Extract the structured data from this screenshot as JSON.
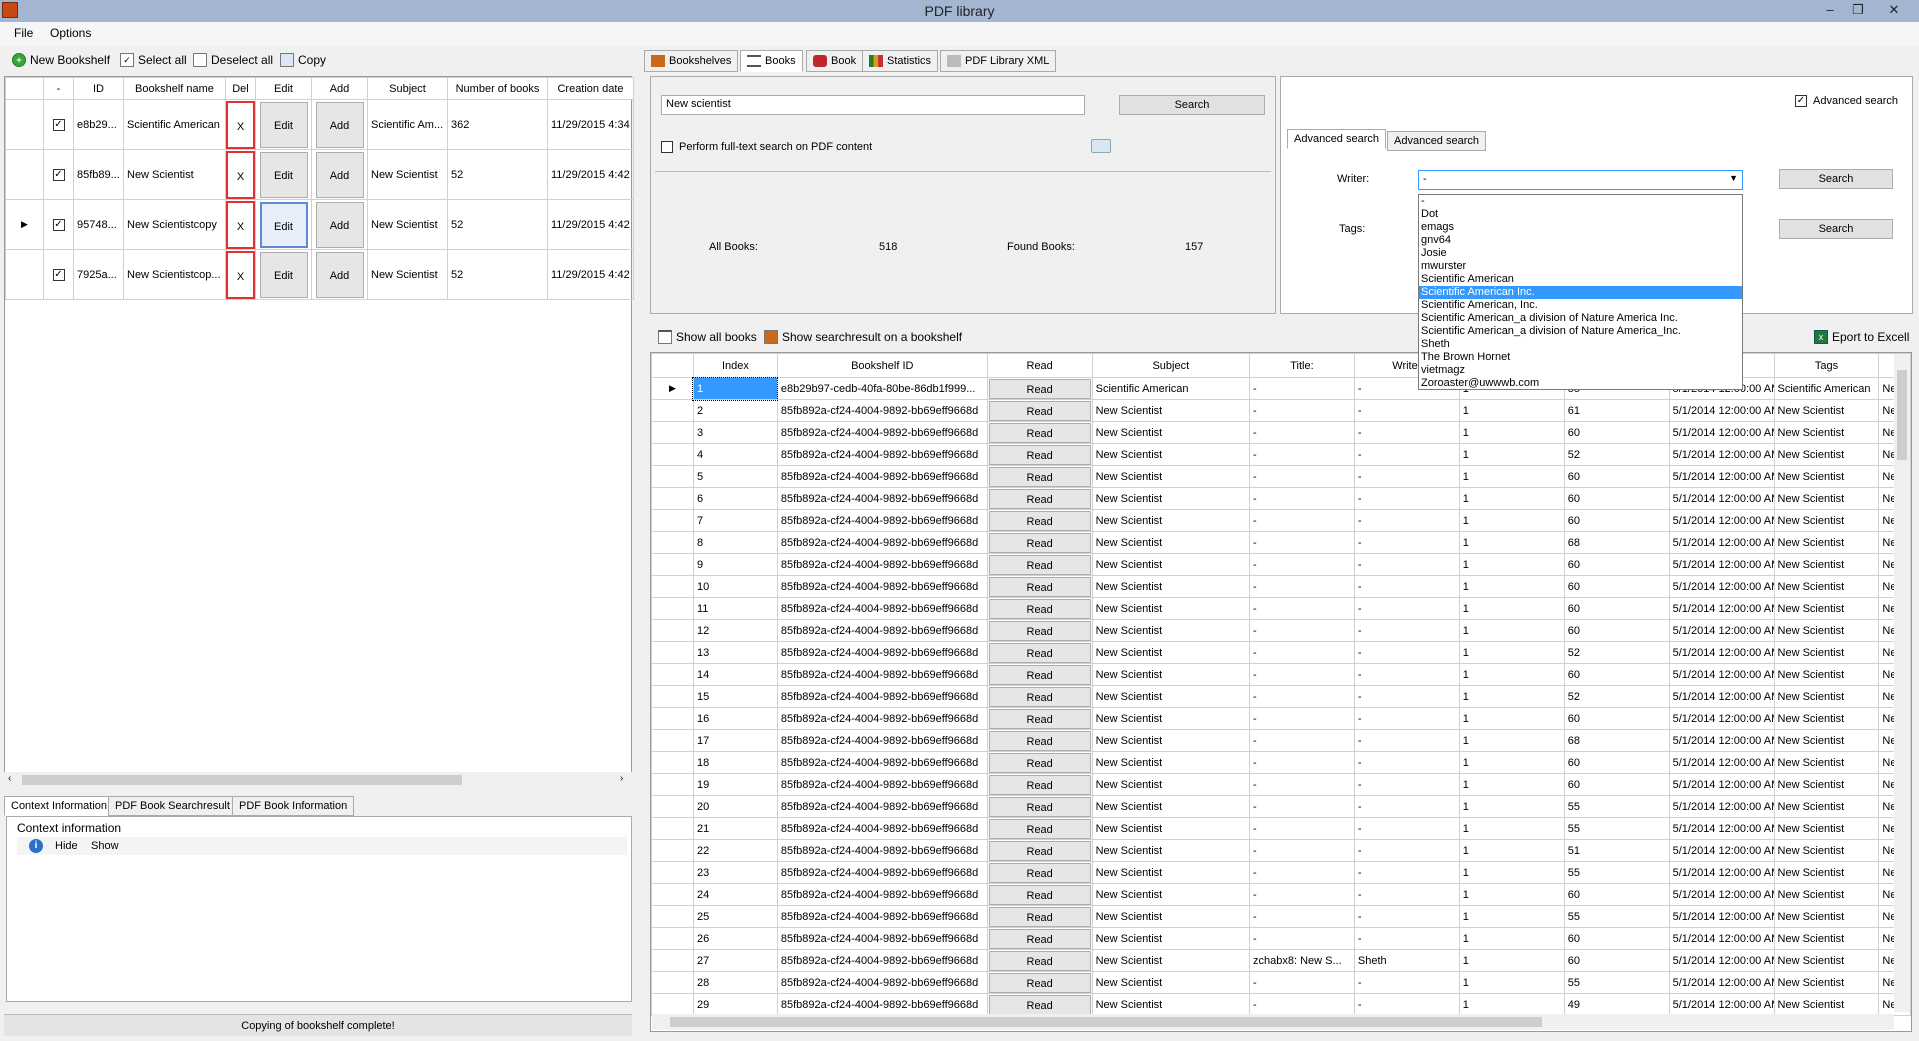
{
  "window": {
    "title": "PDF library",
    "minimize": "–",
    "maximize": "❐",
    "close": "✕"
  },
  "menu": [
    "File",
    "Options"
  ],
  "toolbar": {
    "new_bookshelf": "New Bookshelf",
    "select_all": "Select all",
    "deselect_all": "Deselect all",
    "copy": "Copy"
  },
  "bookshelves": {
    "columns": [
      "-",
      "ID",
      "Bookshelf name",
      "Del",
      "Edit",
      "Add",
      "Subject",
      "Number of books",
      "Creation date"
    ],
    "rows": [
      {
        "id": "e8b29...",
        "name": "Scientific American",
        "del": "X",
        "edit": "Edit",
        "add": "Add",
        "subject": "Scientific Am...",
        "count": "362",
        "date": "11/29/2015 4:34"
      },
      {
        "id": "85fb89...",
        "name": "New Scientist",
        "del": "X",
        "edit": "Edit",
        "add": "Add",
        "subject": "New Scientist",
        "count": "52",
        "date": "11/29/2015 4:42"
      },
      {
        "id": "95748...",
        "name": "New Scientistcopy",
        "del": "X",
        "edit": "Edit",
        "add": "Add",
        "subject": "New Scientist",
        "count": "52",
        "date": "11/29/2015 4:42"
      },
      {
        "id": "7925a...",
        "name": "New Scientistcop...",
        "del": "X",
        "edit": "Edit",
        "add": "Add",
        "subject": "New Scientist",
        "count": "52",
        "date": "11/29/2015 4:42"
      }
    ]
  },
  "bottom_tabs": [
    "Context Information",
    "PDF Book Searchresult",
    "PDF Book Information"
  ],
  "context": {
    "title": "Context information",
    "hide": "Hide",
    "show": "Show"
  },
  "status": "Copying of bookshelf complete!",
  "right_tabs": [
    "Bookshelves",
    "Books",
    "Book",
    "Statistics",
    "PDF Library XML"
  ],
  "search": {
    "query": "New scientist",
    "button": "Search",
    "fulltext_label": "Perform full-text search on PDF content",
    "all_books_label": "All Books:",
    "all_books": "518",
    "found_books_label": "Found Books:",
    "found_books": "157"
  },
  "advanced": {
    "checkbox_label": "Advanced search",
    "tab1": "Advanced search",
    "tab2": "Advanced search",
    "writer_label": "Writer:",
    "tags_label": "Tags:",
    "writer_value": "-",
    "search1": "Search",
    "search2": "Search",
    "options": [
      "-",
      "Dot",
      "emags",
      "gnv64",
      "Josie",
      "mwurster",
      "Scientific American",
      "Scientific American Inc.",
      "Scientific American, Inc.",
      "Scientific American_a division of Nature America Inc.",
      "Scientific American_a division of Nature America_Inc.",
      "Sheth",
      "The Brown Hornet",
      "vietmagz",
      "Zoroaster@uwwwb.com"
    ],
    "selected_index": 7
  },
  "result_bar": {
    "show_all": "Show all books",
    "show_on_shelf": "Show searchresult on a bookshelf",
    "export": "Eport to Excell"
  },
  "books": {
    "columns": [
      "Index",
      "Bookshelf ID",
      "Read",
      "Subject",
      "Title:",
      "Writer",
      "",
      "",
      "",
      "Tags",
      ""
    ],
    "rows": [
      [
        "1",
        "e8b29b97-cedb-40fa-80be-86db1f999...",
        "Read",
        "Scientific American",
        "-",
        "-",
        "1",
        "55",
        "5/1/2014 12:00:00 AM",
        "Scientific American",
        "New S"
      ],
      [
        "2",
        "85fb892a-cf24-4004-9892-bb69eff9668d",
        "Read",
        "New Scientist",
        "-",
        "-",
        "1",
        "61",
        "5/1/2014 12:00:00 AM",
        "New Scientist",
        "New S"
      ],
      [
        "3",
        "85fb892a-cf24-4004-9892-bb69eff9668d",
        "Read",
        "New Scientist",
        "-",
        "-",
        "1",
        "60",
        "5/1/2014 12:00:00 AM",
        "New Scientist",
        "New S"
      ],
      [
        "4",
        "85fb892a-cf24-4004-9892-bb69eff9668d",
        "Read",
        "New Scientist",
        "-",
        "-",
        "1",
        "52",
        "5/1/2014 12:00:00 AM",
        "New Scientist",
        "New S"
      ],
      [
        "5",
        "85fb892a-cf24-4004-9892-bb69eff9668d",
        "Read",
        "New Scientist",
        "-",
        "-",
        "1",
        "60",
        "5/1/2014 12:00:00 AM",
        "New Scientist",
        "New S"
      ],
      [
        "6",
        "85fb892a-cf24-4004-9892-bb69eff9668d",
        "Read",
        "New Scientist",
        "-",
        "-",
        "1",
        "60",
        "5/1/2014 12:00:00 AM",
        "New Scientist",
        "New S"
      ],
      [
        "7",
        "85fb892a-cf24-4004-9892-bb69eff9668d",
        "Read",
        "New Scientist",
        "-",
        "-",
        "1",
        "60",
        "5/1/2014 12:00:00 AM",
        "New Scientist",
        "New S"
      ],
      [
        "8",
        "85fb892a-cf24-4004-9892-bb69eff9668d",
        "Read",
        "New Scientist",
        "-",
        "-",
        "1",
        "68",
        "5/1/2014 12:00:00 AM",
        "New Scientist",
        "New S"
      ],
      [
        "9",
        "85fb892a-cf24-4004-9892-bb69eff9668d",
        "Read",
        "New Scientist",
        "-",
        "-",
        "1",
        "60",
        "5/1/2014 12:00:00 AM",
        "New Scientist",
        "New S"
      ],
      [
        "10",
        "85fb892a-cf24-4004-9892-bb69eff9668d",
        "Read",
        "New Scientist",
        "-",
        "-",
        "1",
        "60",
        "5/1/2014 12:00:00 AM",
        "New Scientist",
        "New S"
      ],
      [
        "11",
        "85fb892a-cf24-4004-9892-bb69eff9668d",
        "Read",
        "New Scientist",
        "-",
        "-",
        "1",
        "60",
        "5/1/2014 12:00:00 AM",
        "New Scientist",
        "New S"
      ],
      [
        "12",
        "85fb892a-cf24-4004-9892-bb69eff9668d",
        "Read",
        "New Scientist",
        "-",
        "-",
        "1",
        "60",
        "5/1/2014 12:00:00 AM",
        "New Scientist",
        "New S"
      ],
      [
        "13",
        "85fb892a-cf24-4004-9892-bb69eff9668d",
        "Read",
        "New Scientist",
        "-",
        "-",
        "1",
        "52",
        "5/1/2014 12:00:00 AM",
        "New Scientist",
        "New S"
      ],
      [
        "14",
        "85fb892a-cf24-4004-9892-bb69eff9668d",
        "Read",
        "New Scientist",
        "-",
        "-",
        "1",
        "60",
        "5/1/2014 12:00:00 AM",
        "New Scientist",
        "New S"
      ],
      [
        "15",
        "85fb892a-cf24-4004-9892-bb69eff9668d",
        "Read",
        "New Scientist",
        "-",
        "-",
        "1",
        "52",
        "5/1/2014 12:00:00 AM",
        "New Scientist",
        "New S"
      ],
      [
        "16",
        "85fb892a-cf24-4004-9892-bb69eff9668d",
        "Read",
        "New Scientist",
        "-",
        "-",
        "1",
        "60",
        "5/1/2014 12:00:00 AM",
        "New Scientist",
        "New S"
      ],
      [
        "17",
        "85fb892a-cf24-4004-9892-bb69eff9668d",
        "Read",
        "New Scientist",
        "-",
        "-",
        "1",
        "68",
        "5/1/2014 12:00:00 AM",
        "New Scientist",
        "New S"
      ],
      [
        "18",
        "85fb892a-cf24-4004-9892-bb69eff9668d",
        "Read",
        "New Scientist",
        "-",
        "-",
        "1",
        "60",
        "5/1/2014 12:00:00 AM",
        "New Scientist",
        "New S"
      ],
      [
        "19",
        "85fb892a-cf24-4004-9892-bb69eff9668d",
        "Read",
        "New Scientist",
        "-",
        "-",
        "1",
        "60",
        "5/1/2014 12:00:00 AM",
        "New Scientist",
        "New S"
      ],
      [
        "20",
        "85fb892a-cf24-4004-9892-bb69eff9668d",
        "Read",
        "New Scientist",
        "-",
        "-",
        "1",
        "55",
        "5/1/2014 12:00:00 AM",
        "New Scientist",
        "New S"
      ],
      [
        "21",
        "85fb892a-cf24-4004-9892-bb69eff9668d",
        "Read",
        "New Scientist",
        "-",
        "-",
        "1",
        "55",
        "5/1/2014 12:00:00 AM",
        "New Scientist",
        "New S"
      ],
      [
        "22",
        "85fb892a-cf24-4004-9892-bb69eff9668d",
        "Read",
        "New Scientist",
        "-",
        "-",
        "1",
        "51",
        "5/1/2014 12:00:00 AM",
        "New Scientist",
        "New S"
      ],
      [
        "23",
        "85fb892a-cf24-4004-9892-bb69eff9668d",
        "Read",
        "New Scientist",
        "-",
        "-",
        "1",
        "55",
        "5/1/2014 12:00:00 AM",
        "New Scientist",
        "New S"
      ],
      [
        "24",
        "85fb892a-cf24-4004-9892-bb69eff9668d",
        "Read",
        "New Scientist",
        "-",
        "-",
        "1",
        "60",
        "5/1/2014 12:00:00 AM",
        "New Scientist",
        "New S"
      ],
      [
        "25",
        "85fb892a-cf24-4004-9892-bb69eff9668d",
        "Read",
        "New Scientist",
        "-",
        "-",
        "1",
        "55",
        "5/1/2014 12:00:00 AM",
        "New Scientist",
        "New S"
      ],
      [
        "26",
        "85fb892a-cf24-4004-9892-bb69eff9668d",
        "Read",
        "New Scientist",
        "-",
        "-",
        "1",
        "60",
        "5/1/2014 12:00:00 AM",
        "New Scientist",
        "New S"
      ],
      [
        "27",
        "85fb892a-cf24-4004-9892-bb69eff9668d",
        "Read",
        "New Scientist",
        "zchabx8: New S...",
        "Sheth",
        "1",
        "60",
        "5/1/2014 12:00:00 AM",
        "New Scientist",
        "New S"
      ],
      [
        "28",
        "85fb892a-cf24-4004-9892-bb69eff9668d",
        "Read",
        "New Scientist",
        "-",
        "-",
        "1",
        "55",
        "5/1/2014 12:00:00 AM",
        "New Scientist",
        "New S"
      ],
      [
        "29",
        "85fb892a-cf24-4004-9892-bb69eff9668d",
        "Read",
        "New Scientist",
        "-",
        "-",
        "1",
        "49",
        "5/1/2014 12:00:00 AM",
        "New Scientist",
        "New S"
      ]
    ]
  }
}
